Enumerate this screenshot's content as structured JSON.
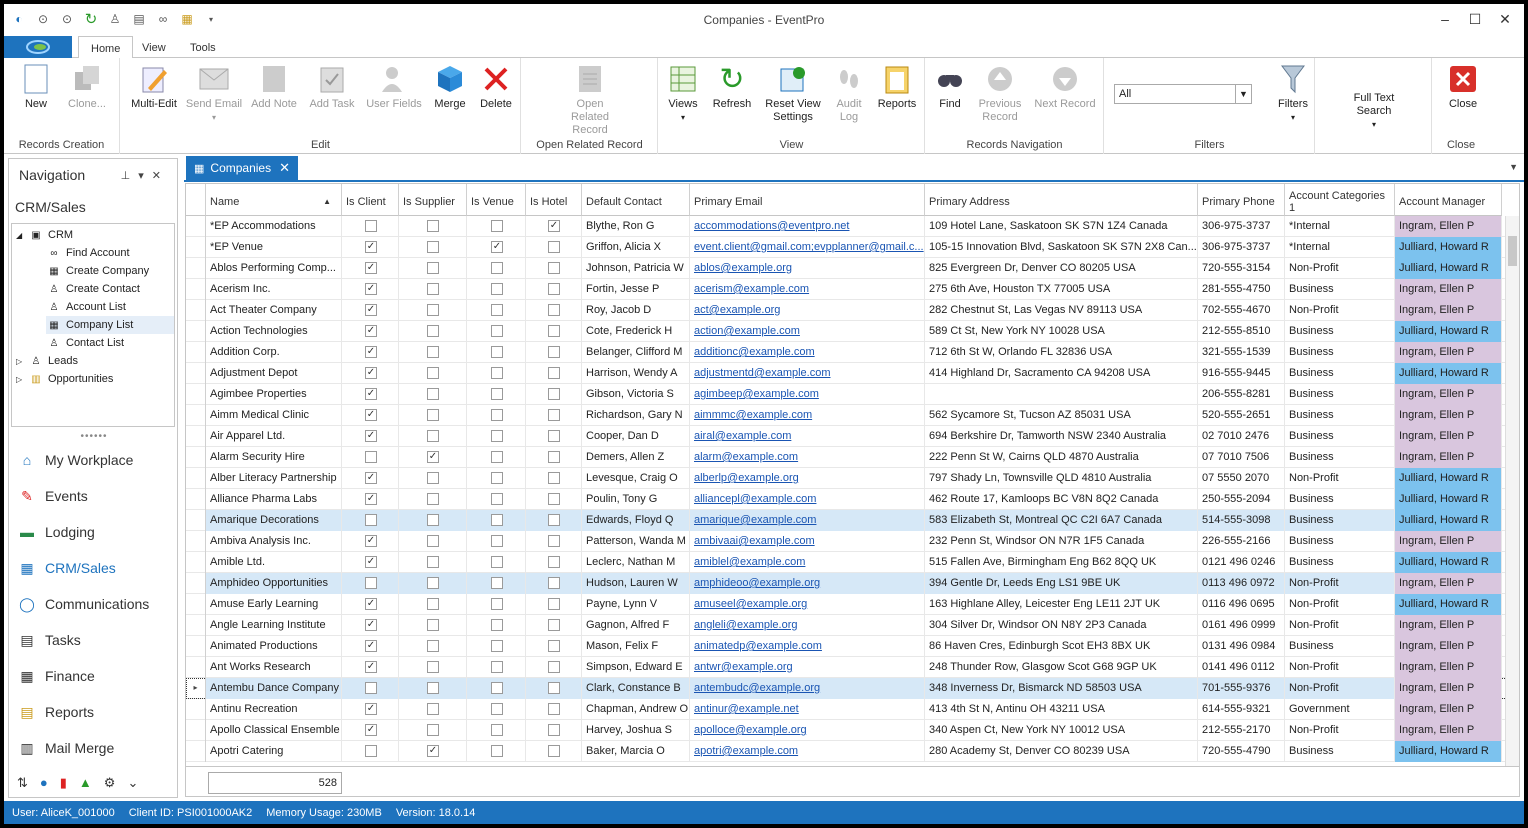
{
  "window": {
    "title": "Companies - EventPro"
  },
  "ribbon_tabs": [
    "Home",
    "View",
    "Tools"
  ],
  "ribbon": {
    "groups": [
      {
        "label": "Records Creation",
        "buttons": [
          "New",
          "Clone..."
        ]
      },
      {
        "label": "Edit",
        "buttons": [
          "Multi-Edit",
          "Send Email",
          "Add Note",
          "Add Task",
          "User Fields",
          "Merge",
          "Delete"
        ]
      },
      {
        "label": "Open Related Record",
        "buttons": [
          "Open Related Record"
        ]
      },
      {
        "label": "View",
        "buttons": [
          "Views",
          "Refresh",
          "Reset View Settings",
          "Audit Log",
          "Reports"
        ]
      },
      {
        "label": "Records Navigation",
        "buttons": [
          "Find",
          "Previous Record",
          "Next Record"
        ]
      },
      {
        "label": "Filters",
        "buttons": [
          "Filters"
        ]
      },
      {
        "label": "",
        "buttons": [
          "Full Text Search"
        ]
      },
      {
        "label": "Close",
        "buttons": [
          "Close"
        ]
      }
    ],
    "filter_value": "All"
  },
  "nav": {
    "title": "Navigation",
    "section": "CRM/Sales",
    "tree": [
      "CRM",
      "Find Account",
      "Create Company",
      "Create Contact",
      "Account List",
      "Company List",
      "Contact List",
      "Leads",
      "Opportunities"
    ],
    "items": [
      "My Workplace",
      "Events",
      "Lodging",
      "CRM/Sales",
      "Communications",
      "Tasks",
      "Finance",
      "Reports",
      "Mail Merge"
    ]
  },
  "doc_tab": "Companies",
  "columns": [
    "Name",
    "Is Client",
    "Is Supplier",
    "Is Venue",
    "Is Hotel",
    "Default Contact",
    "Primary Email",
    "Primary Address",
    "Primary Phone",
    "Account Categories 1",
    "Account Manager"
  ],
  "rows": [
    [
      "*EP Accommodations",
      0,
      0,
      0,
      1,
      "Blythe, Ron G",
      "accommodations@eventpro.net",
      "109 Hotel Lane, Saskatoon SK S7N 1Z4 Canada",
      "306-975-3737",
      "*Internal",
      "Ingram, Ellen P"
    ],
    [
      "*EP Venue",
      1,
      0,
      1,
      0,
      "Griffon, Alicia X",
      "event.client@gmail.com;evpplanner@gmail.c...",
      "105-15 Innovation Blvd, Saskatoon SK S7N 2X8 Can...",
      "306-975-3737",
      "*Internal",
      "Julliard, Howard R"
    ],
    [
      "Ablos Performing Comp...",
      1,
      0,
      0,
      0,
      "Johnson, Patricia W",
      "ablos@example.org",
      "825 Evergreen Dr, Denver CO 80205 USA",
      "720-555-3154",
      "Non-Profit",
      "Julliard, Howard R"
    ],
    [
      "Acerism Inc.",
      1,
      0,
      0,
      0,
      "Fortin, Jesse P",
      "acerism@example.com",
      "275 6th Ave, Houston TX 77005 USA",
      "281-555-4750",
      "Business",
      "Ingram, Ellen P"
    ],
    [
      "Act Theater Company",
      1,
      0,
      0,
      0,
      "Roy, Jacob D",
      "act@example.org",
      "282 Chestnut St, Las Vegas NV 89113 USA",
      "702-555-4670",
      "Non-Profit",
      "Ingram, Ellen P"
    ],
    [
      "Action Technologies",
      1,
      0,
      0,
      0,
      "Cote, Frederick H",
      "action@example.com",
      "589 Ct St, New York NY 10028 USA",
      "212-555-8510",
      "Business",
      "Julliard, Howard R"
    ],
    [
      "Addition Corp.",
      1,
      0,
      0,
      0,
      "Belanger, Clifford M",
      "additionc@example.com",
      "712 6th St W, Orlando FL 32836 USA",
      "321-555-1539",
      "Business",
      "Ingram, Ellen P"
    ],
    [
      "Adjustment Depot",
      1,
      0,
      0,
      0,
      "Harrison, Wendy A",
      "adjustmentd@example.com",
      "414 Highland Dr, Sacramento CA 94208 USA",
      "916-555-9445",
      "Business",
      "Julliard, Howard R"
    ],
    [
      "Agimbee Properties",
      1,
      0,
      0,
      0,
      "Gibson, Victoria S",
      "agimbeep@example.com",
      "",
      "206-555-8281",
      "Business",
      "Ingram, Ellen P"
    ],
    [
      "Aimm Medical Clinic",
      1,
      0,
      0,
      0,
      "Richardson, Gary N",
      "aimmmc@example.com",
      "562 Sycamore St, Tucson AZ 85031 USA",
      "520-555-2651",
      "Business",
      "Ingram, Ellen P"
    ],
    [
      "Air Apparel Ltd.",
      1,
      0,
      0,
      0,
      "Cooper, Dan D",
      "airal@example.com",
      "694 Berkshire Dr, Tamworth NSW 2340 Australia",
      "02 7010 2476",
      "Business",
      "Ingram, Ellen P"
    ],
    [
      "Alarm Security Hire",
      0,
      1,
      0,
      0,
      "Demers, Allen Z",
      "alarm@example.com",
      "222 Penn St W, Cairns QLD 4870 Australia",
      "07 7010 7506",
      "Business",
      "Ingram, Ellen P"
    ],
    [
      "Alber Literacy Partnership",
      1,
      0,
      0,
      0,
      "Levesque, Craig O",
      "alberlp@example.org",
      "797 Shady Ln, Townsville QLD 4810 Australia",
      "07 5550 2070",
      "Non-Profit",
      "Julliard, Howard R"
    ],
    [
      "Alliance Pharma Labs",
      1,
      0,
      0,
      0,
      "Poulin, Tony G",
      "alliancepl@example.com",
      "462 Route 17, Kamloops BC V8N 8Q2 Canada",
      "250-555-2094",
      "Business",
      "Julliard, Howard R"
    ],
    [
      "Amarique Decorations",
      0,
      0,
      0,
      0,
      "Edwards, Floyd Q",
      "amarique@example.com",
      "583 Elizabeth St, Montreal QC C2I 6A7 Canada",
      "514-555-3098",
      "Business",
      "Julliard, Howard R"
    ],
    [
      "Ambiva Analysis Inc.",
      1,
      0,
      0,
      0,
      "Patterson, Wanda M",
      "ambivaai@example.com",
      "232 Penn St, Windsor ON N7R 1F5 Canada",
      "226-555-2166",
      "Business",
      "Ingram, Ellen P"
    ],
    [
      "Amible Ltd.",
      1,
      0,
      0,
      0,
      "Leclerc, Nathan M",
      "amiblel@example.com",
      "515 Fallen Ave, Birmingham Eng B62 8QQ UK",
      "0121 496 0246",
      "Business",
      "Julliard, Howard R"
    ],
    [
      "Amphideo Opportunities",
      0,
      0,
      0,
      0,
      "Hudson, Lauren W",
      "amphideoo@example.org",
      "394 Gentle Dr, Leeds Eng LS1 9BE UK",
      "0113 496 0972",
      "Non-Profit",
      "Ingram, Ellen P"
    ],
    [
      "Amuse Early Learning",
      1,
      0,
      0,
      0,
      "Payne, Lynn V",
      "amuseel@example.org",
      "163 Highlane Alley, Leicester Eng LE11 2JT UK",
      "0116 496 0695",
      "Non-Profit",
      "Julliard, Howard R"
    ],
    [
      "Angle Learning Institute",
      1,
      0,
      0,
      0,
      "Gagnon, Alfred F",
      "angleli@example.org",
      "304 Silver Dr, Windsor ON N8Y 2P3 Canada",
      "0161 496 0999",
      "Non-Profit",
      "Ingram, Ellen P"
    ],
    [
      "Animated Productions",
      1,
      0,
      0,
      0,
      "Mason, Felix F",
      "animatedp@example.com",
      "86 Haven Cres, Edinburgh Scot EH3 8BX UK",
      "0131 496 0984",
      "Business",
      "Ingram, Ellen P"
    ],
    [
      "Ant Works Research",
      1,
      0,
      0,
      0,
      "Simpson, Edward E",
      "antwr@example.org",
      "248 Thunder Row, Glasgow Scot G68 9GP UK",
      "0141 496 0112",
      "Non-Profit",
      "Ingram, Ellen P"
    ],
    [
      "Antembu Dance Company",
      0,
      0,
      0,
      0,
      "Clark, Constance B",
      "antembudc@example.org",
      "348 Inverness Dr, Bismarck ND 58503 USA",
      "701-555-9376",
      "Non-Profit",
      "Ingram, Ellen P"
    ],
    [
      "Antinu Recreation",
      1,
      0,
      0,
      0,
      "Chapman, Andrew O",
      "antinur@example.net",
      "413 4th St N, Antinu OH 43211 USA",
      "614-555-9321",
      "Government",
      "Ingram, Ellen P"
    ],
    [
      "Apollo Classical Ensemble",
      1,
      0,
      0,
      0,
      "Harvey, Joshua S",
      "apolloce@example.org",
      "340 Aspen Ct, New York NY 10012 USA",
      "212-555-2170",
      "Non-Profit",
      "Ingram, Ellen P"
    ],
    [
      "Apotri Catering",
      0,
      1,
      0,
      0,
      "Baker, Marcia O",
      "apotri@example.com",
      "280 Academy St, Denver CO 80239 USA",
      "720-555-4790",
      "Business",
      "Julliard, Howard R"
    ]
  ],
  "record_count": "528",
  "status": {
    "user": "User: AliceK_001000",
    "client": "Client ID: PSI001000AK2",
    "memory": "Memory Usage: 230MB",
    "version": "Version: 18.0.14"
  }
}
